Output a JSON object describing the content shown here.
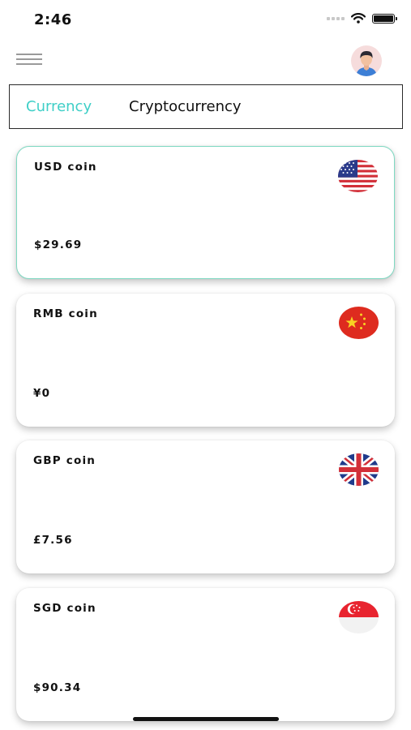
{
  "status_bar": {
    "time": "2:46"
  },
  "tabs": [
    {
      "label": "Currency",
      "active": true
    },
    {
      "label": "Cryptocurrency",
      "active": false
    }
  ],
  "colors": {
    "accent": "#3fcfc7",
    "selected_border": "#7fd9c2"
  },
  "cards": [
    {
      "name": "USD coin",
      "value": "$29.69",
      "flag": "usa-flag-icon",
      "selected": true
    },
    {
      "name": "RMB coin",
      "value": "¥0",
      "flag": "china-flag-icon",
      "selected": false
    },
    {
      "name": "GBP coin",
      "value": "£7.56",
      "flag": "uk-flag-icon",
      "selected": false
    },
    {
      "name": "SGD coin",
      "value": "$90.34",
      "flag": "singapore-flag-icon",
      "selected": false
    }
  ]
}
